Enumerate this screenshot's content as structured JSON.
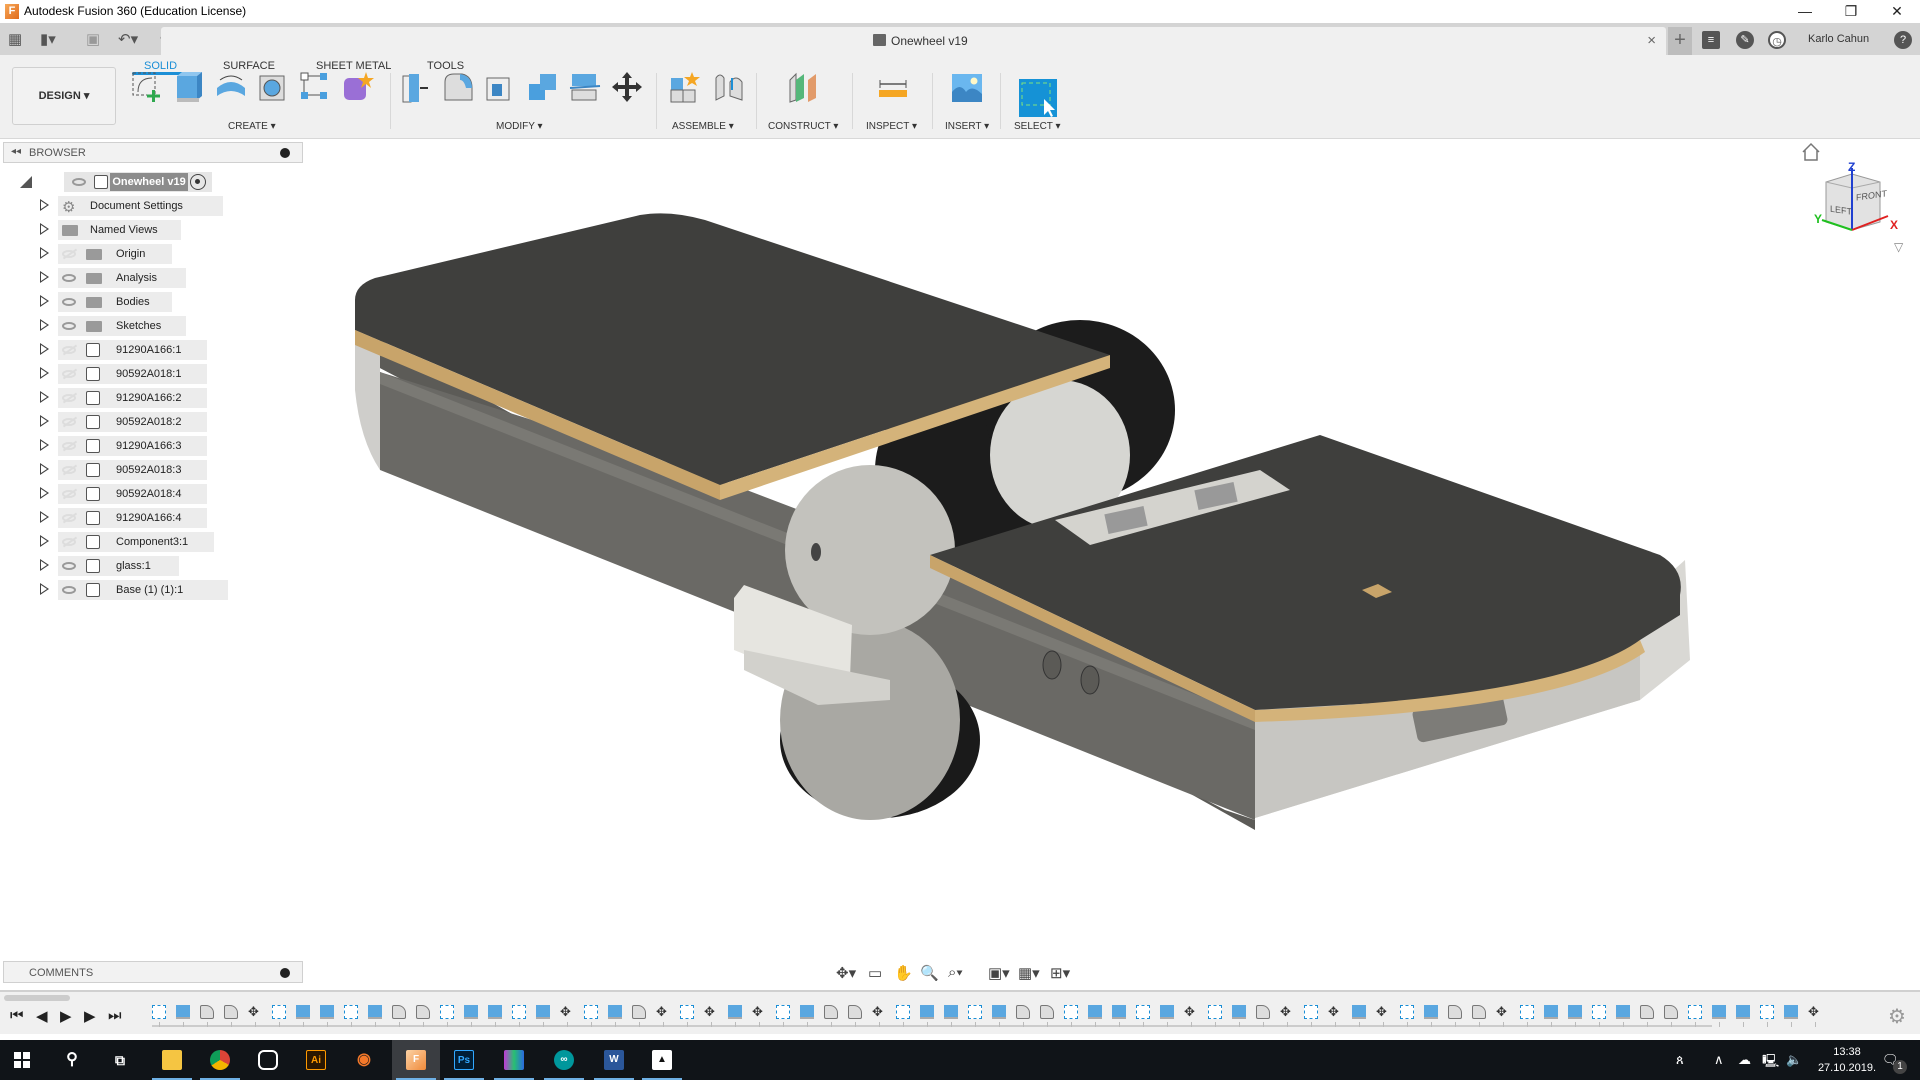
{
  "window": {
    "title": "Autodesk Fusion 360 (Education License)",
    "minimize": "—",
    "restore": "❐",
    "close": "✕"
  },
  "quick_access": {
    "document_tab": "Onewheel v19",
    "close_tab": "×",
    "new_tab": "+",
    "user_name": "Karlo Cahun",
    "help": "?"
  },
  "toolbar": {
    "workspace": "DESIGN ▾",
    "tabs": [
      {
        "label": "SOLID",
        "active": true
      },
      {
        "label": "SURFACE",
        "active": false
      },
      {
        "label": "SHEET METAL",
        "active": false
      },
      {
        "label": "TOOLS",
        "active": false
      }
    ],
    "groups": [
      {
        "label": "CREATE ▾"
      },
      {
        "label": "MODIFY ▾"
      },
      {
        "label": "ASSEMBLE ▾"
      },
      {
        "label": "CONSTRUCT ▾"
      },
      {
        "label": "INSPECT ▾"
      },
      {
        "label": "INSERT ▾"
      },
      {
        "label": "SELECT ▾"
      }
    ]
  },
  "browser": {
    "header": "BROWSER",
    "root": "Onewheel v19",
    "items": [
      {
        "label": "Document Settings",
        "icon": "gear",
        "eye": "none"
      },
      {
        "label": "Named Views",
        "icon": "folder",
        "eye": "none"
      },
      {
        "label": "Origin",
        "icon": "folder",
        "eye": "hidden"
      },
      {
        "label": "Analysis",
        "icon": "folder",
        "eye": "visible"
      },
      {
        "label": "Bodies",
        "icon": "folder",
        "eye": "visible"
      },
      {
        "label": "Sketches",
        "icon": "folder",
        "eye": "visible"
      },
      {
        "label": "91290A166:1",
        "icon": "component",
        "eye": "hidden"
      },
      {
        "label": "90592A018:1",
        "icon": "component",
        "eye": "hidden"
      },
      {
        "label": "91290A166:2",
        "icon": "component",
        "eye": "hidden"
      },
      {
        "label": "90592A018:2",
        "icon": "component",
        "eye": "hidden"
      },
      {
        "label": "91290A166:3",
        "icon": "component",
        "eye": "hidden"
      },
      {
        "label": "90592A018:3",
        "icon": "component",
        "eye": "hidden"
      },
      {
        "label": "90592A018:4",
        "icon": "component",
        "eye": "hidden"
      },
      {
        "label": "91290A166:4",
        "icon": "component",
        "eye": "hidden"
      },
      {
        "label": "Component3:1",
        "icon": "component",
        "eye": "hidden"
      },
      {
        "label": "glass:1",
        "icon": "component",
        "eye": "visible"
      },
      {
        "label": "Base (1) (1):1",
        "icon": "component",
        "eye": "visible"
      }
    ]
  },
  "viewcube": {
    "faces": [
      "LEFT",
      "FRONT"
    ],
    "axes": [
      "X",
      "Y",
      "Z"
    ]
  },
  "comments": {
    "label": "COMMENTS"
  },
  "navbar": {
    "icons": [
      "orbit-icon",
      "look-at-icon",
      "pan-icon",
      "zoom-icon",
      "fit-icon",
      "display-settings-icon",
      "grid-settings-icon",
      "viewports-icon"
    ]
  },
  "timeline": {
    "controls": [
      "⏮",
      "◀",
      "▶",
      "▶",
      "⏭"
    ],
    "feature_count": 70
  },
  "taskbar": {
    "apps": [
      "Start",
      "Search",
      "Task View",
      "File Explorer",
      "Chrome",
      "Mixed Reality",
      "Illustrator",
      "Blender",
      "Fusion 360",
      "Photoshop",
      "App",
      "Arduino",
      "Word",
      "Photos"
    ],
    "time": "13:38",
    "date": "27.10.2019.",
    "notification_count": "1"
  },
  "colors": {
    "accent": "#1c8fd6",
    "deck": "#3f3f3d",
    "wood": "#c8a46a",
    "body": "#6b6a66"
  }
}
